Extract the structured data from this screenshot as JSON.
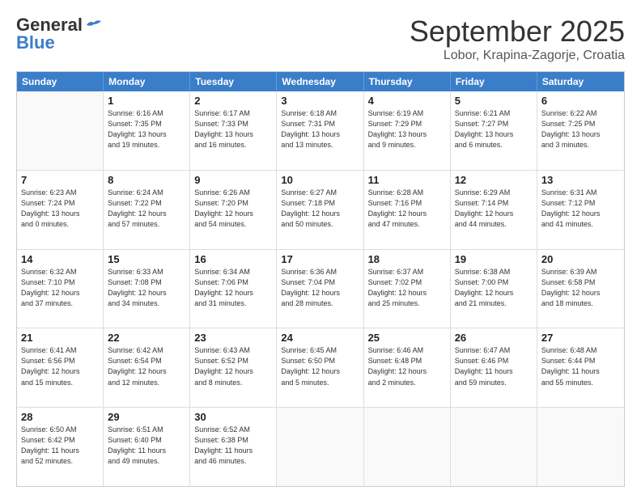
{
  "header": {
    "logo_general": "General",
    "logo_blue": "Blue",
    "month_title": "September 2025",
    "location": "Lobor, Krapina-Zagorje, Croatia"
  },
  "days_of_week": [
    "Sunday",
    "Monday",
    "Tuesday",
    "Wednesday",
    "Thursday",
    "Friday",
    "Saturday"
  ],
  "weeks": [
    [
      {
        "day": "",
        "info": ""
      },
      {
        "day": "1",
        "info": "Sunrise: 6:16 AM\nSunset: 7:35 PM\nDaylight: 13 hours\nand 19 minutes."
      },
      {
        "day": "2",
        "info": "Sunrise: 6:17 AM\nSunset: 7:33 PM\nDaylight: 13 hours\nand 16 minutes."
      },
      {
        "day": "3",
        "info": "Sunrise: 6:18 AM\nSunset: 7:31 PM\nDaylight: 13 hours\nand 13 minutes."
      },
      {
        "day": "4",
        "info": "Sunrise: 6:19 AM\nSunset: 7:29 PM\nDaylight: 13 hours\nand 9 minutes."
      },
      {
        "day": "5",
        "info": "Sunrise: 6:21 AM\nSunset: 7:27 PM\nDaylight: 13 hours\nand 6 minutes."
      },
      {
        "day": "6",
        "info": "Sunrise: 6:22 AM\nSunset: 7:25 PM\nDaylight: 13 hours\nand 3 minutes."
      }
    ],
    [
      {
        "day": "7",
        "info": "Sunrise: 6:23 AM\nSunset: 7:24 PM\nDaylight: 13 hours\nand 0 minutes."
      },
      {
        "day": "8",
        "info": "Sunrise: 6:24 AM\nSunset: 7:22 PM\nDaylight: 12 hours\nand 57 minutes."
      },
      {
        "day": "9",
        "info": "Sunrise: 6:26 AM\nSunset: 7:20 PM\nDaylight: 12 hours\nand 54 minutes."
      },
      {
        "day": "10",
        "info": "Sunrise: 6:27 AM\nSunset: 7:18 PM\nDaylight: 12 hours\nand 50 minutes."
      },
      {
        "day": "11",
        "info": "Sunrise: 6:28 AM\nSunset: 7:16 PM\nDaylight: 12 hours\nand 47 minutes."
      },
      {
        "day": "12",
        "info": "Sunrise: 6:29 AM\nSunset: 7:14 PM\nDaylight: 12 hours\nand 44 minutes."
      },
      {
        "day": "13",
        "info": "Sunrise: 6:31 AM\nSunset: 7:12 PM\nDaylight: 12 hours\nand 41 minutes."
      }
    ],
    [
      {
        "day": "14",
        "info": "Sunrise: 6:32 AM\nSunset: 7:10 PM\nDaylight: 12 hours\nand 37 minutes."
      },
      {
        "day": "15",
        "info": "Sunrise: 6:33 AM\nSunset: 7:08 PM\nDaylight: 12 hours\nand 34 minutes."
      },
      {
        "day": "16",
        "info": "Sunrise: 6:34 AM\nSunset: 7:06 PM\nDaylight: 12 hours\nand 31 minutes."
      },
      {
        "day": "17",
        "info": "Sunrise: 6:36 AM\nSunset: 7:04 PM\nDaylight: 12 hours\nand 28 minutes."
      },
      {
        "day": "18",
        "info": "Sunrise: 6:37 AM\nSunset: 7:02 PM\nDaylight: 12 hours\nand 25 minutes."
      },
      {
        "day": "19",
        "info": "Sunrise: 6:38 AM\nSunset: 7:00 PM\nDaylight: 12 hours\nand 21 minutes."
      },
      {
        "day": "20",
        "info": "Sunrise: 6:39 AM\nSunset: 6:58 PM\nDaylight: 12 hours\nand 18 minutes."
      }
    ],
    [
      {
        "day": "21",
        "info": "Sunrise: 6:41 AM\nSunset: 6:56 PM\nDaylight: 12 hours\nand 15 minutes."
      },
      {
        "day": "22",
        "info": "Sunrise: 6:42 AM\nSunset: 6:54 PM\nDaylight: 12 hours\nand 12 minutes."
      },
      {
        "day": "23",
        "info": "Sunrise: 6:43 AM\nSunset: 6:52 PM\nDaylight: 12 hours\nand 8 minutes."
      },
      {
        "day": "24",
        "info": "Sunrise: 6:45 AM\nSunset: 6:50 PM\nDaylight: 12 hours\nand 5 minutes."
      },
      {
        "day": "25",
        "info": "Sunrise: 6:46 AM\nSunset: 6:48 PM\nDaylight: 12 hours\nand 2 minutes."
      },
      {
        "day": "26",
        "info": "Sunrise: 6:47 AM\nSunset: 6:46 PM\nDaylight: 11 hours\nand 59 minutes."
      },
      {
        "day": "27",
        "info": "Sunrise: 6:48 AM\nSunset: 6:44 PM\nDaylight: 11 hours\nand 55 minutes."
      }
    ],
    [
      {
        "day": "28",
        "info": "Sunrise: 6:50 AM\nSunset: 6:42 PM\nDaylight: 11 hours\nand 52 minutes."
      },
      {
        "day": "29",
        "info": "Sunrise: 6:51 AM\nSunset: 6:40 PM\nDaylight: 11 hours\nand 49 minutes."
      },
      {
        "day": "30",
        "info": "Sunrise: 6:52 AM\nSunset: 6:38 PM\nDaylight: 11 hours\nand 46 minutes."
      },
      {
        "day": "",
        "info": ""
      },
      {
        "day": "",
        "info": ""
      },
      {
        "day": "",
        "info": ""
      },
      {
        "day": "",
        "info": ""
      }
    ]
  ]
}
